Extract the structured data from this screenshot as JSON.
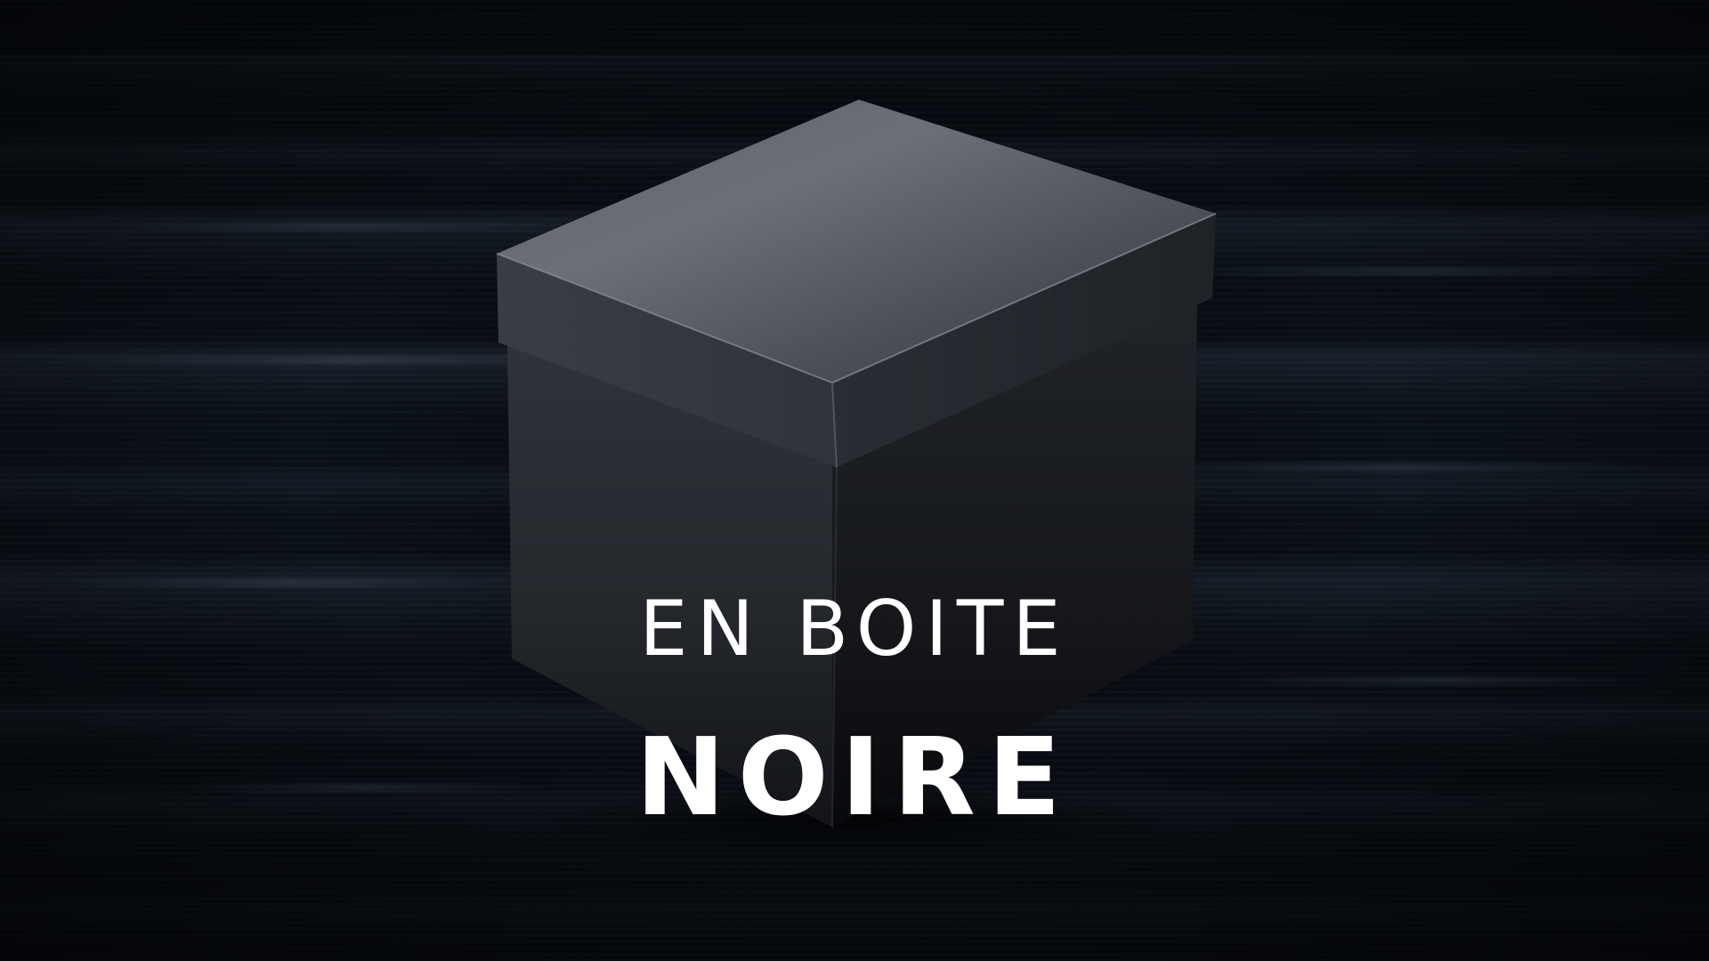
{
  "title": {
    "line1": "EN BOITE",
    "line2": "NOIRE"
  },
  "colors": {
    "background": "#070b10",
    "text": "#ffffff",
    "box_lid": "#4a4e55",
    "box_left": "#2a2d33",
    "box_right": "#1a1c21"
  },
  "image": {
    "subject": "black-gift-box"
  }
}
